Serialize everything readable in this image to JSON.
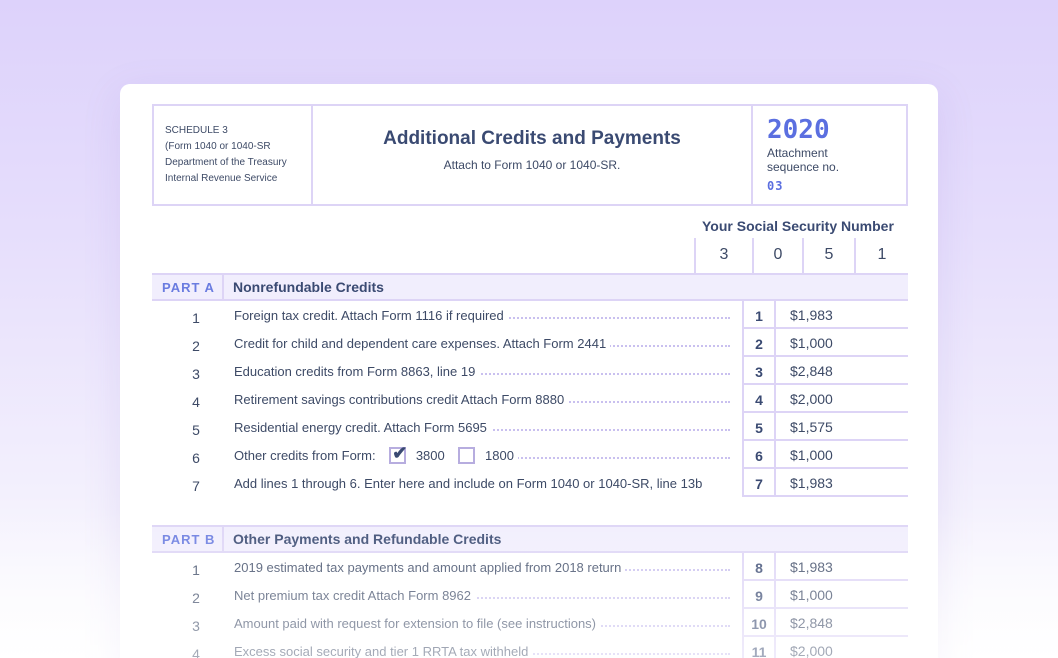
{
  "header": {
    "schedule": "SCHEDULE 3",
    "form_ref": "(Form 1040 or 1040-SR",
    "department": "Department of the Treasury",
    "agency": "Internal Revenue Service",
    "title": "Additional Credits and Payments",
    "subtitle": "Attach to Form 1040 or 1040-SR.",
    "year": "2020",
    "attachment_line1": "Attachment",
    "attachment_line2": "sequence no.",
    "sequence_no": "03"
  },
  "ssn": {
    "title": "Your Social Security Number",
    "digits": [
      "3",
      "0",
      "5",
      "1"
    ]
  },
  "part_a": {
    "label": "PART A",
    "title": "Nonrefundable Credits",
    "rows": [
      {
        "num": "1",
        "desc": "Foreign tax credit. Attach Form 1116 if required",
        "line": "1",
        "amount": "$1,983"
      },
      {
        "num": "2",
        "desc": "Credit for child and dependent care expenses. Attach Form 2441",
        "line": "2",
        "amount": "$1,000"
      },
      {
        "num": "3",
        "desc": "Education credits from Form 8863, line 19",
        "line": "3",
        "amount": "$2,848"
      },
      {
        "num": "4",
        "desc": "Retirement savings contributions credit Attach Form 8880",
        "line": "4",
        "amount": "$2,000"
      },
      {
        "num": "5",
        "desc": "Residential energy credit. Attach Form 5695",
        "line": "5",
        "amount": "$1,575"
      },
      {
        "num": "6",
        "desc": "Other credits from Form:",
        "line": "6",
        "amount": "$1,000",
        "opt1": "3800",
        "opt2": "1800",
        "opt1_checked": true,
        "opt2_checked": false
      },
      {
        "num": "7",
        "desc": "Add lines 1 through 6. Enter here and include on Form 1040 or 1040-SR, line 13b",
        "line": "7",
        "amount": "$1,983"
      }
    ]
  },
  "part_b": {
    "label": "PART B",
    "title": "Other Payments and Refundable Credits",
    "rows": [
      {
        "num": "1",
        "desc": "2019 estimated tax payments and amount applied from 2018 return",
        "line": "8",
        "amount": "$1,983"
      },
      {
        "num": "2",
        "desc": "Net premium tax credit Attach Form 8962",
        "line": "9",
        "amount": "$1,000"
      },
      {
        "num": "3",
        "desc": "Amount paid with request for extension to file (see instructions)",
        "line": "10",
        "amount": "$2,848"
      },
      {
        "num": "4",
        "desc": "Excess social security and tier 1 RRTA tax withheld",
        "line": "11",
        "amount": "$2,000"
      }
    ]
  }
}
